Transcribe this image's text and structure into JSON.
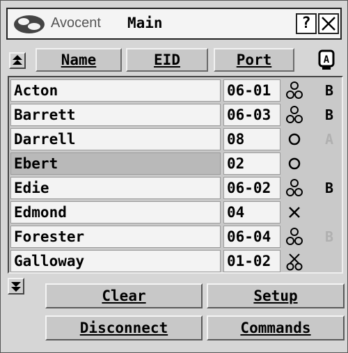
{
  "window": {
    "brand": "Avocent",
    "title": "Main",
    "help_label": "?",
    "close_label": "X"
  },
  "header": {
    "name_label": "Name",
    "eid_label": "EID",
    "port_label": "Port",
    "channel_icon_label": "A"
  },
  "rows": [
    {
      "name": "Acton",
      "port": "06-01",
      "status": "connected-icon",
      "channel": "B",
      "channel_active": true
    },
    {
      "name": "Barrett",
      "port": "06-03",
      "status": "connected-icon",
      "channel": "B",
      "channel_active": true
    },
    {
      "name": "Darrell",
      "port": "08",
      "status": "online-icon",
      "channel": "A",
      "channel_active": false
    },
    {
      "name": "Ebert",
      "port": "02",
      "status": "online-icon",
      "channel": "",
      "channel_active": false,
      "selected": true
    },
    {
      "name": "Edie",
      "port": "06-02",
      "status": "connected-icon",
      "channel": "B",
      "channel_active": true
    },
    {
      "name": "Edmond",
      "port": "04",
      "status": "offline-icon",
      "channel": "",
      "channel_active": false
    },
    {
      "name": "Forester",
      "port": "06-04",
      "status": "connected-icon",
      "channel": "B",
      "channel_active": false
    },
    {
      "name": "Galloway",
      "port": "01-02",
      "status": "blocked-icon",
      "channel": "",
      "channel_active": false
    }
  ],
  "buttons": {
    "clear": {
      "label": "Clear"
    },
    "setup": {
      "label": "Setup"
    },
    "disconnect": {
      "label": "Disconnect"
    },
    "commands": {
      "label": "Commands"
    }
  },
  "colors": {
    "window_bg": "#d6d6d6",
    "cell_bg": "#f3f3f3",
    "selected_bg": "#b9b9b9",
    "inactive_text": "#b0b0b0"
  }
}
